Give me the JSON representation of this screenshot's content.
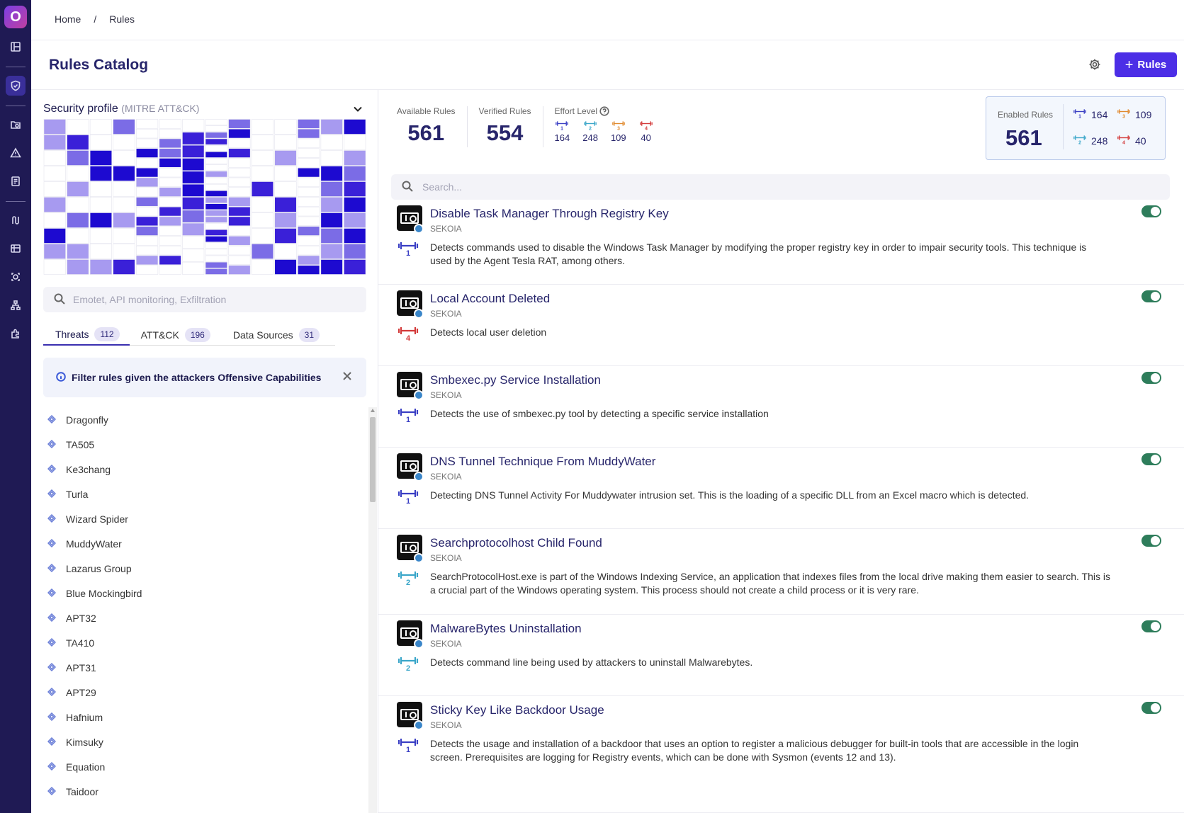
{
  "breadcrumb": {
    "home": "Home",
    "sep": "/",
    "current": "Rules"
  },
  "header": {
    "title": "Rules Catalog",
    "add_button": "Rules"
  },
  "security_profile": {
    "title": "Security profile",
    "subtitle": "(MITRE ATT&CK)"
  },
  "left_search": {
    "placeholder": "Emotet, API monitoring, Exfiltration"
  },
  "tabs": [
    {
      "label": "Threats",
      "count": "112"
    },
    {
      "label": "ATT&CK",
      "count": "196"
    },
    {
      "label": "Data Sources",
      "count": "31"
    }
  ],
  "filter_banner": "Filter rules given the attackers Offensive Capabilities",
  "threats": [
    "Dragonfly",
    "TA505",
    "Ke3chang",
    "Turla",
    "Wizard Spider",
    "MuddyWater",
    "Lazarus Group",
    "Blue Mockingbird",
    "APT32",
    "TA410",
    "APT31",
    "APT29",
    "Hafnium",
    "Kimsuky",
    "Equation",
    "Taidoor"
  ],
  "stats": {
    "available_label": "Available Rules",
    "available": "561",
    "verified_label": "Verified Rules",
    "verified": "554",
    "effort_label": "Effort Level",
    "effort": [
      {
        "level": "1",
        "count": "164",
        "color": "#3a3fc4"
      },
      {
        "level": "2",
        "count": "248",
        "color": "#3aa6c9"
      },
      {
        "level": "3",
        "count": "109",
        "color": "#e08a2e"
      },
      {
        "level": "4",
        "count": "40",
        "color": "#d33a3a"
      }
    ]
  },
  "enabled": {
    "label": "Enabled Rules",
    "value": "561",
    "e1": "164",
    "e3": "109",
    "e2": "248",
    "e4": "40"
  },
  "rule_search": {
    "placeholder": "Search..."
  },
  "rules": [
    {
      "title": "Disable Task Manager Through Registry Key",
      "vendor": "SEKOIA",
      "effort": "1",
      "desc": "Detects commands used to disable the Windows Task Manager by modifying the proper registry key in order to impair security tools. This technique is used by the Agent Tesla RAT, among others."
    },
    {
      "title": "Local Account Deleted",
      "vendor": "SEKOIA",
      "effort": "4",
      "desc": "Detects local user deletion"
    },
    {
      "title": "Smbexec.py Service Installation",
      "vendor": "SEKOIA",
      "effort": "1",
      "desc": "Detects the use of smbexec.py tool by detecting a specific service installation"
    },
    {
      "title": "DNS Tunnel Technique From MuddyWater",
      "vendor": "SEKOIA",
      "effort": "1",
      "desc": "Detecting DNS Tunnel Activity For Muddywater intrusion set. This is the loading of a specific DLL from an Excel macro which is detected."
    },
    {
      "title": "Searchprotocolhost Child Found",
      "vendor": "SEKOIA",
      "effort": "2",
      "desc": "SearchProtocolHost.exe is part of the Windows Indexing Service, an application that indexes files from the local drive making them easier to search. This is a crucial part of the Windows operating system. This process should not create a child process or it is very rare."
    },
    {
      "title": "MalwareBytes Uninstallation",
      "vendor": "SEKOIA",
      "effort": "2",
      "desc": "Detects command line being used by attackers to uninstall Malwarebytes."
    },
    {
      "title": "Sticky Key Like Backdoor Usage",
      "vendor": "SEKOIA",
      "effort": "1",
      "desc": "Detects the usage and installation of a backdoor that uses an option to register a malicious debugger for built-in tools that are accessible in the login screen. Prerequisites are logging for Registry events, which can be done with Sysmon (events 12 and 13)."
    }
  ]
}
